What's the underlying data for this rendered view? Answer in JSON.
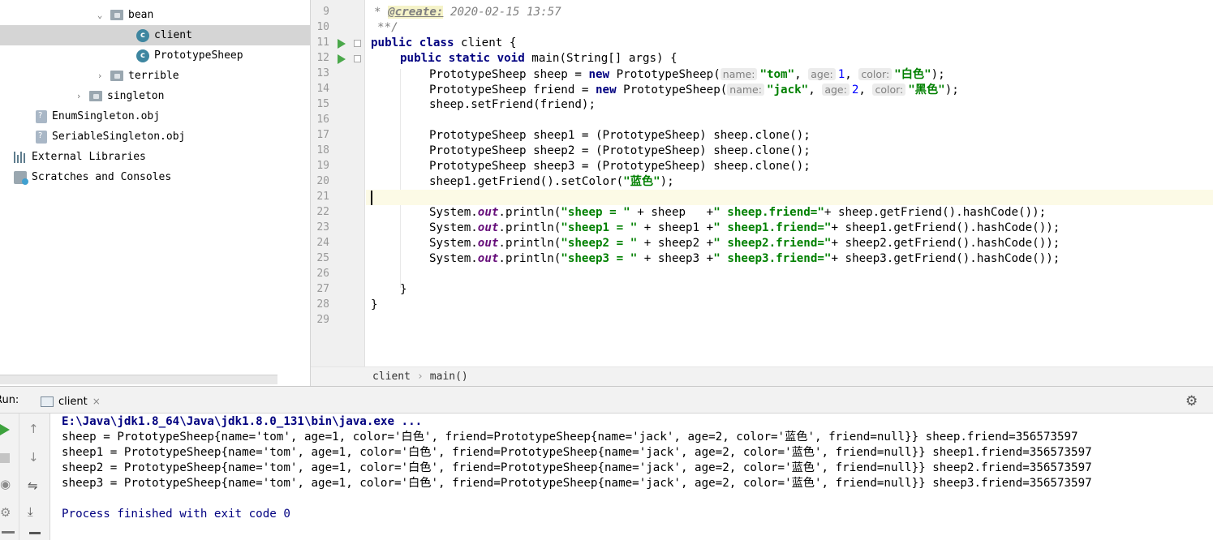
{
  "project_tree": {
    "items": [
      {
        "label": "bean",
        "type": "folder",
        "expanded": true
      },
      {
        "label": "client",
        "type": "class",
        "selected": true
      },
      {
        "label": "PrototypeSheep",
        "type": "class"
      },
      {
        "label": "terrible",
        "type": "folder",
        "expanded": false
      },
      {
        "label": "singleton",
        "type": "folder",
        "expanded": false
      },
      {
        "label": "EnumSingleton.obj",
        "type": "file"
      },
      {
        "label": "SeriableSingleton.obj",
        "type": "file"
      },
      {
        "label": "External Libraries",
        "type": "libraries"
      },
      {
        "label": "Scratches and Consoles",
        "type": "scratches"
      }
    ]
  },
  "editor": {
    "line_numbers": [
      "9",
      "10",
      "11",
      "12",
      "13",
      "14",
      "15",
      "16",
      "17",
      "18",
      "19",
      "20",
      "21",
      "22",
      "23",
      "24",
      "25",
      "26",
      "27",
      "28",
      "29"
    ],
    "doc_create_tag": "@create:",
    "doc_create_value": "2020-02-15 13:57",
    "doc_end": "**/",
    "line11": {
      "kw": "public class",
      "rest": "client {"
    },
    "line12": {
      "kw": "public static void",
      "rest": "main(String[] args) {"
    },
    "line13": {
      "p1": "PrototypeSheep sheep = ",
      "kw": "new",
      "p2": " PrototypeSheep(",
      "hint_name": "name:",
      "s_name": "\"tom\"",
      "hint_age": "age:",
      "n_age": "1",
      "hint_color": "color:",
      "s_color": "\"白色\"",
      "end": ");"
    },
    "line14": {
      "p1": "PrototypeSheep friend = ",
      "kw": "new",
      "p2": " PrototypeSheep(",
      "hint_name": "name:",
      "s_name": "\"jack\"",
      "hint_age": "age:",
      "n_age": "2",
      "hint_color": "color:",
      "s_color": "\"黑色\"",
      "end": ");"
    },
    "line15": "sheep.setFriend(friend);",
    "line17": "PrototypeSheep sheep1 = (PrototypeSheep) sheep.clone();",
    "line18": "PrototypeSheep sheep2 = (PrototypeSheep) sheep.clone();",
    "line19": "PrototypeSheep sheep3 = (PrototypeSheep) sheep.clone();",
    "line20": {
      "p1": "sheep1.getFriend().setColor(",
      "s": "\"蓝色\"",
      "end": ");"
    },
    "println_lines": [
      {
        "pre": "System.",
        "fld": "out",
        "mid": ".println(",
        "s1": "\"sheep = \"",
        "m1": " + sheep   +",
        "s2": "\" sheep.friend=\"",
        "m2": "+ sheep.getFriend().hashCode());"
      },
      {
        "pre": "System.",
        "fld": "out",
        "mid": ".println(",
        "s1": "\"sheep1 = \"",
        "m1": " + sheep1 +",
        "s2": "\" sheep1.friend=\"",
        "m2": "+ sheep1.getFriend().hashCode());"
      },
      {
        "pre": "System.",
        "fld": "out",
        "mid": ".println(",
        "s1": "\"sheep2 = \"",
        "m1": " + sheep2 +",
        "s2": "\" sheep2.friend=\"",
        "m2": "+ sheep2.getFriend().hashCode());"
      },
      {
        "pre": "System.",
        "fld": "out",
        "mid": ".println(",
        "s1": "\"sheep3 = \"",
        "m1": " + sheep3 +",
        "s2": "\" sheep3.friend=\"",
        "m2": "+ sheep3.getFriend().hashCode());"
      }
    ],
    "line27": "}",
    "line28": "}"
  },
  "breadcrumb": {
    "class": "client",
    "separator": "›",
    "method": "main()"
  },
  "run_panel": {
    "label": "Run:",
    "tab_label": "client",
    "tab_close": "×",
    "settings_icon": "⚙",
    "console": {
      "command": "E:\\Java\\jdk1.8_64\\Java\\jdk1.8.0_131\\bin\\java.exe ...",
      "output": [
        "sheep = PrototypeSheep{name='tom', age=1, color='白色', friend=PrototypeSheep{name='jack', age=2, color='蓝色', friend=null}} sheep.friend=356573597",
        "sheep1 = PrototypeSheep{name='tom', age=1, color='白色', friend=PrototypeSheep{name='jack', age=2, color='蓝色', friend=null}} sheep1.friend=356573597",
        "sheep2 = PrototypeSheep{name='tom', age=1, color='白色', friend=PrototypeSheep{name='jack', age=2, color='蓝色', friend=null}} sheep2.friend=356573597",
        "sheep3 = PrototypeSheep{name='tom', age=1, color='白色', friend=PrototypeSheep{name='jack', age=2, color='蓝色', friend=null}} sheep3.friend=356573597"
      ],
      "exit": "Process finished with exit code 0"
    }
  },
  "colors": {
    "keyword": "#000080",
    "string": "#008000",
    "number": "#0000ff",
    "static_field": "#660e7a",
    "selection": "#d5d5d5",
    "current_line": "#fcfae6"
  }
}
